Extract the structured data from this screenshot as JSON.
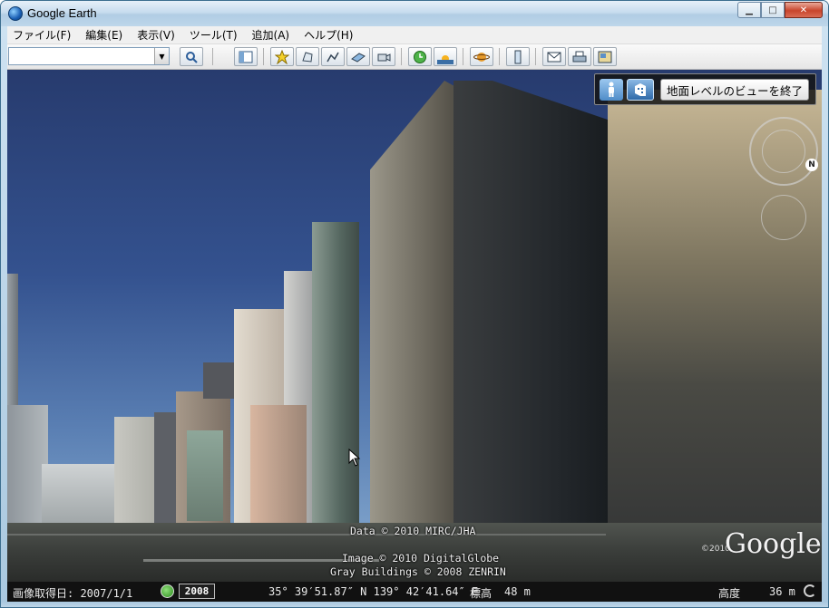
{
  "window": {
    "title": "Google Earth",
    "min_glyph": "▁",
    "max_glyph": "□",
    "close_glyph": "✕"
  },
  "menu": {
    "items": [
      {
        "label": "ファイル(F)"
      },
      {
        "label": "編集(E)"
      },
      {
        "label": "表示(V)"
      },
      {
        "label": "ツール(T)"
      },
      {
        "label": "追加(A)"
      },
      {
        "label": "ヘルプ(H)"
      }
    ]
  },
  "toolbar": {
    "search_value": "",
    "search_placeholder": "",
    "icons": [
      "search-icon",
      "sidebar-icon",
      "placemark-icon",
      "polygon-icon",
      "path-icon",
      "image-overlay-icon",
      "record-tour-icon",
      "historical-imagery-icon",
      "sunlight-icon",
      "planets-icon",
      "ruler-icon",
      "email-icon",
      "print-icon",
      "save-image-icon"
    ]
  },
  "view": {
    "exit_ground_label": "地面レベルのビューを終了",
    "credits": {
      "data": "Data © 2010 MIRC/JHA",
      "image": "Image © 2010 DigitalGlobe",
      "buildings": "Gray Buildings © 2008 ZENRIN"
    },
    "logo": "Google",
    "logo_year": "©2010"
  },
  "status": {
    "image_date_label": "画像取得日: 2007/1/1",
    "year": "2008",
    "coords": "35° 39′51.87″ N 139° 42′41.64″ E",
    "elevation_label": "標高",
    "elevation_value": "48 m",
    "eye_alt_label": "高度",
    "eye_alt_value": "36 m"
  },
  "colors": {
    "sky_top": "#273b6e",
    "status_bg": "#111111",
    "accent": "#2f6aa8"
  }
}
